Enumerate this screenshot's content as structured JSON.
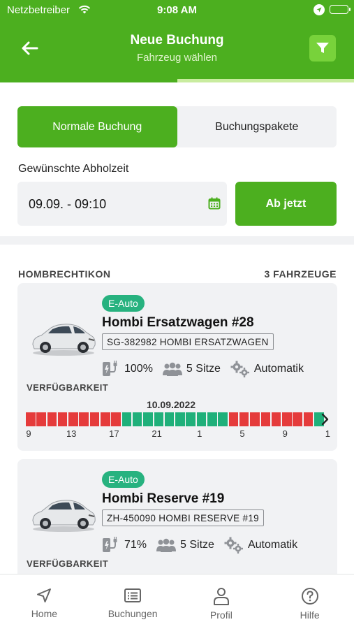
{
  "status_bar": {
    "carrier": "Netzbetreiber",
    "time": "9:08 AM"
  },
  "header": {
    "title": "Neue Buchung",
    "subtitle": "Fahrzeug wählen",
    "progress": 0.5,
    "colors": {
      "primary": "#4caf1f",
      "progress_track": "#c9ec9f"
    }
  },
  "booking_type": {
    "options": [
      "Normale Buchung",
      "Buchungspakete"
    ],
    "selected": "Normale Buchung"
  },
  "pickup": {
    "label": "Gewünschte Abholzeit",
    "value": "09.09. - 09:10",
    "now_button": "Ab jetzt"
  },
  "location": {
    "name": "HOMBRECHTIKON",
    "count": "3 FAHRZEUGE"
  },
  "vehicles": [
    {
      "badge": "E-Auto",
      "name": "Hombi Ersatzwagen #28",
      "plate": "SG-382982 HOMBI ERSATZWAGEN",
      "battery": "100%",
      "seats": "5 Sitze",
      "transmission": "Automatik",
      "availability_label": "VERFÜGBARKEIT",
      "availability_date": "10.09.2022",
      "availability_slots": [
        "r",
        "r",
        "r",
        "r",
        "r",
        "r",
        "r",
        "r",
        "r",
        "g",
        "g",
        "g",
        "g",
        "g",
        "g",
        "g",
        "g",
        "g",
        "g",
        "r",
        "r",
        "r",
        "r",
        "r",
        "r",
        "r",
        "r",
        "g"
      ],
      "hour_ticks": [
        "9",
        "13",
        "17",
        "21",
        "1",
        "5",
        "9",
        "1"
      ]
    },
    {
      "badge": "E-Auto",
      "name": "Hombi Reserve #19",
      "plate": "ZH-450090 HOMBI RESERVE #19",
      "battery": "71%",
      "seats": "5 Sitze",
      "transmission": "Automatik",
      "availability_label": "VERFÜGBARKEIT"
    }
  ],
  "tabbar": {
    "items": [
      {
        "label": "Home",
        "icon": "navigation-arrow-icon"
      },
      {
        "label": "Buchungen",
        "icon": "list-icon"
      },
      {
        "label": "Profil",
        "icon": "person-icon"
      },
      {
        "label": "Hilfe",
        "icon": "help-icon"
      }
    ]
  }
}
